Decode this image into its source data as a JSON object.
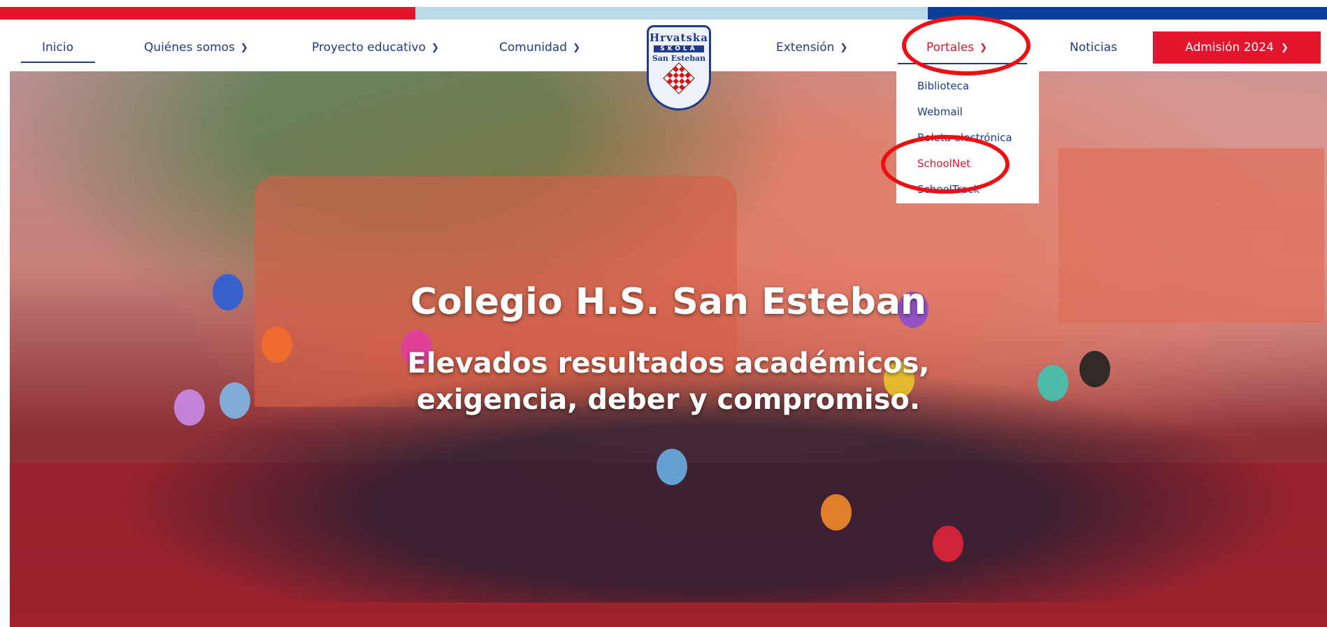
{
  "colors": {
    "brand_red": "#e3142b",
    "brand_blue": "#1f3a8a",
    "bar_light": "#bcd9ea",
    "bar_blue": "#0b3e9a",
    "annotation_red": "#ef0f12"
  },
  "nav": {
    "items": [
      {
        "label": "Inicio"
      },
      {
        "label": "Quiénes somos"
      },
      {
        "label": "Proyecto educativo"
      },
      {
        "label": "Comunidad"
      },
      {
        "label": "Extensión"
      },
      {
        "label": "Portales"
      },
      {
        "label": "Noticias"
      }
    ],
    "cta_label": "Admisión 2024"
  },
  "logo": {
    "line1": "Hrvatska",
    "line2": "ŠKOLA",
    "line3": "San Esteban"
  },
  "dropdown": {
    "items": [
      "Biblioteca",
      "Webmail",
      "Boleta electrónica",
      "SchoolNet",
      "SchoolTrack"
    ]
  },
  "hero": {
    "title": "Colegio H.S. San Esteban",
    "subtitle_line1": "Elevados resultados académicos,",
    "subtitle_line2": "exigencia, deber y compromiso."
  },
  "icons": {
    "chevron": "chevron-down-icon"
  }
}
